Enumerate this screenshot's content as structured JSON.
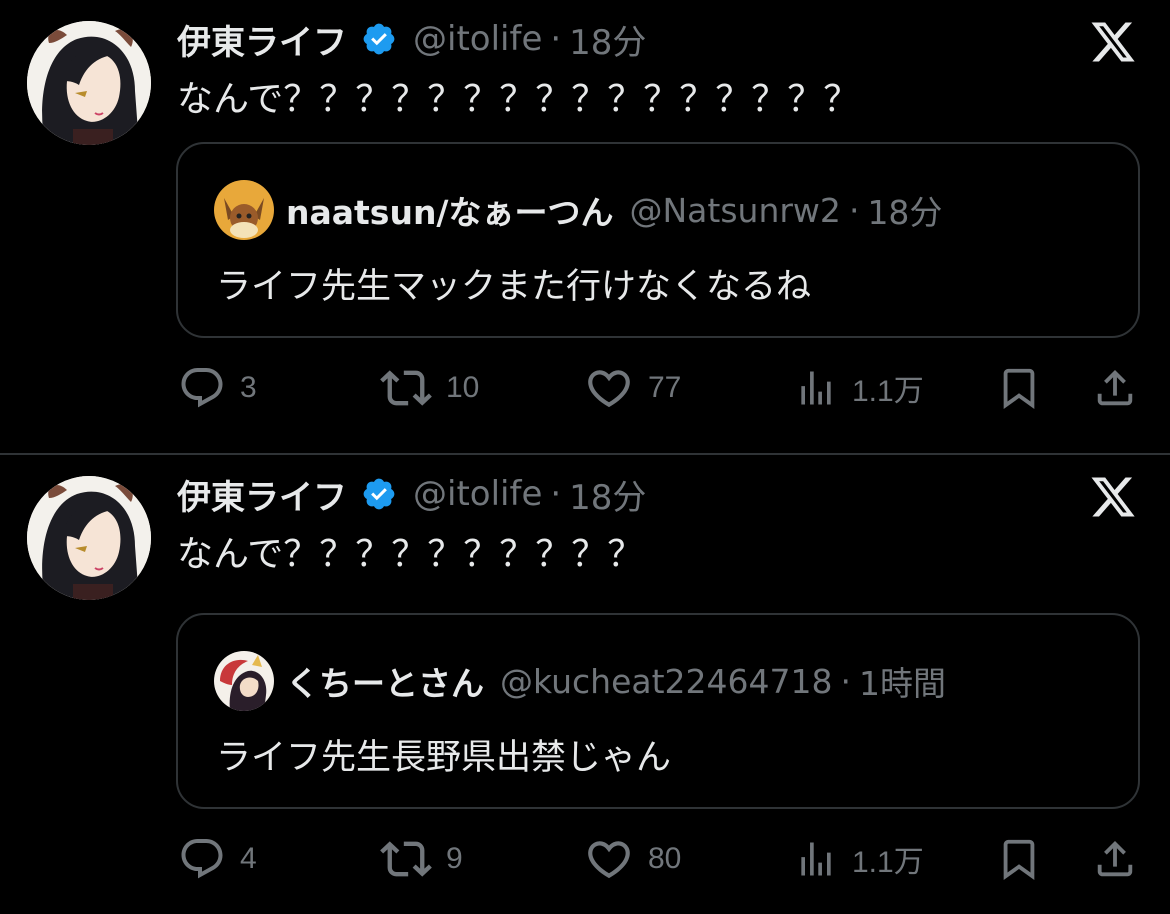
{
  "tweets": [
    {
      "author": {
        "name": "伊東ライフ",
        "handle": "@itolife",
        "time": "18分",
        "verified": true
      },
      "text": "なんで？？？？？？？？？？？？？？？？",
      "quote": {
        "name": "naatsun/なぁーつん",
        "handle": "@Natsunrw2",
        "time": "18分",
        "text": "ライフ先生マックまた行けなくなるね"
      },
      "stats": {
        "replies": "3",
        "retweets": "10",
        "likes": "77",
        "views": "1.1万"
      }
    },
    {
      "author": {
        "name": "伊東ライフ",
        "handle": "@itolife",
        "time": "18分",
        "verified": true
      },
      "text": "なんで？？？？？？？？？？",
      "quote": {
        "name": "くちーとさん",
        "handle": "@kucheat22464718",
        "time": "1時間",
        "text": "ライフ先生長野県出禁じゃん"
      },
      "stats": {
        "replies": "4",
        "retweets": "9",
        "likes": "80",
        "views": "1.1万"
      }
    }
  ],
  "dot_separator": "·",
  "colors": {
    "background": "#000000",
    "text": "#e7e9ea",
    "secondary": "#71767b",
    "verified": "#1d9bf0",
    "border": "#2f3336"
  },
  "icons": [
    "x-logo-icon",
    "verified-badge-icon",
    "reply-icon",
    "retweet-icon",
    "like-icon",
    "views-icon",
    "bookmark-icon",
    "share-icon"
  ]
}
